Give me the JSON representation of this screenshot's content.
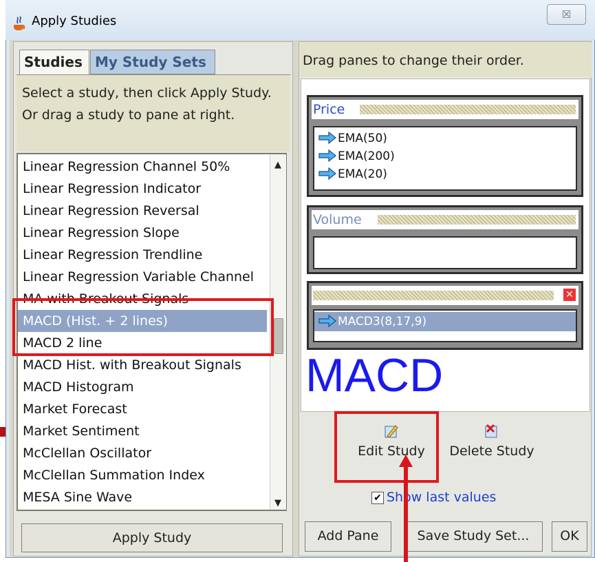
{
  "window": {
    "title": "Apply Studies",
    "close_glyph": "☒"
  },
  "tabs": [
    {
      "label": "Studies",
      "active": true
    },
    {
      "label": "My Study Sets",
      "active": false
    }
  ],
  "left": {
    "instructions": "Select a study, then click Apply Study. Or drag a study to pane at right.",
    "studies": [
      "Linear Regression Channel 50%",
      "Linear Regression Indicator",
      "Linear Regression Reversal",
      "Linear Regression Slope",
      "Linear Regression Trendline",
      "Linear Regression Variable Channel",
      "MA with Breakout Signals",
      "MACD (Hist. + 2 lines)",
      "MACD 2 line",
      "MACD Hist. with Breakout Signals",
      "MACD Histogram",
      "Market Forecast",
      "Market Sentiment",
      "McClellan Oscillator",
      "McClellan Summation Index",
      "MESA Sine Wave"
    ],
    "selected_study": "MACD (Hist. + 2 lines)",
    "apply_button": "Apply Study"
  },
  "right": {
    "hint": "Drag panes to change their order.",
    "panes": [
      {
        "name": "Price",
        "studies": [
          "EMA(50)",
          "EMA(200)",
          "EMA(20)"
        ]
      },
      {
        "name": "Volume",
        "studies": []
      },
      {
        "name": "",
        "studies": [
          "MACD3(8,17,9)"
        ],
        "selected": "MACD3(8,17,9)"
      }
    ],
    "big_label": "MACD",
    "edit_button": "Edit Study",
    "delete_button": "Delete Study",
    "show_last_values": {
      "label": "Show last values",
      "checked": true,
      "check_glyph": "✔"
    },
    "add_pane_button": "Add Pane",
    "save_set_button": "Save Study Set...",
    "ok_button": "OK"
  },
  "colors": {
    "accent_blue": "#1a1aef",
    "selection": "#8ea3c5",
    "annotation_red": "#e0181e"
  }
}
